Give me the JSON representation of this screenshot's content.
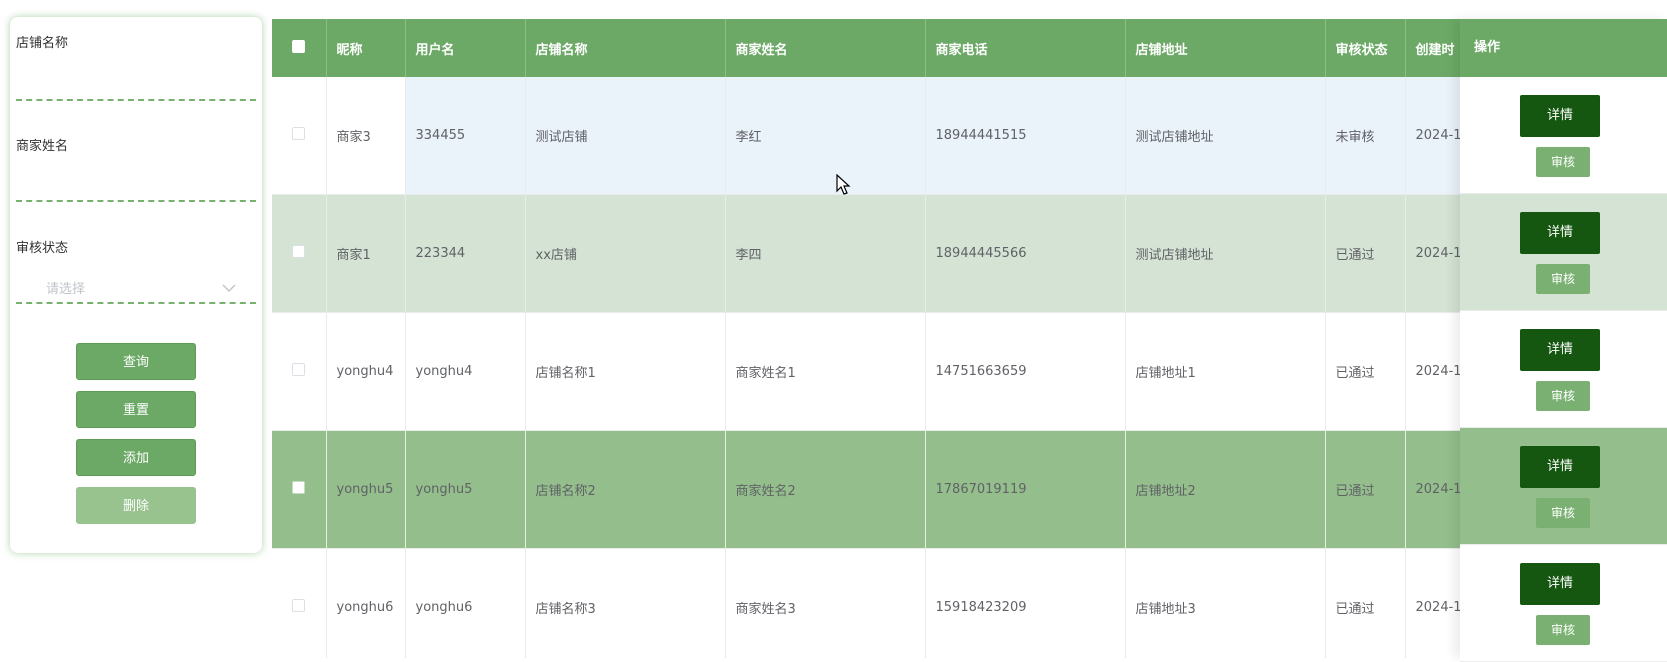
{
  "search": {
    "shop_name_label": "店铺名称",
    "merchant_name_label": "商家姓名",
    "audit_status_label": "审核状态",
    "audit_status_placeholder": "请选择",
    "query_label": "查询",
    "reset_label": "重置",
    "add_label": "添加",
    "delete_label": "删除"
  },
  "table": {
    "headers": {
      "nickname": "昵称",
      "username": "用户名",
      "shop_name": "店铺名称",
      "merchant_name": "商家姓名",
      "phone": "商家电话",
      "address": "店铺地址",
      "status": "审核状态",
      "created": "创建时",
      "actions": "操作"
    },
    "rows": [
      {
        "nickname": "商家3",
        "username": "334455",
        "shop_name": "测试店铺",
        "merchant_name": "李红",
        "phone": "18944441515",
        "address": "测试店铺地址",
        "status": "未审核",
        "created": "2024-1"
      },
      {
        "nickname": "商家1",
        "username": "223344",
        "shop_name": "xx店铺",
        "merchant_name": "李四",
        "phone": "18944445566",
        "address": "测试店铺地址",
        "status": "已通过",
        "created": "2024-1"
      },
      {
        "nickname": "yonghu4",
        "username": "yonghu4",
        "shop_name": "店铺名称1",
        "merchant_name": "商家姓名1",
        "phone": "14751663659",
        "address": "店铺地址1",
        "status": "已通过",
        "created": "2024-1"
      },
      {
        "nickname": "yonghu5",
        "username": "yonghu5",
        "shop_name": "店铺名称2",
        "merchant_name": "商家姓名2",
        "phone": "17867019119",
        "address": "店铺地址2",
        "status": "已通过",
        "created": "2024-1"
      },
      {
        "nickname": "yonghu6",
        "username": "yonghu6",
        "shop_name": "店铺名称3",
        "merchant_name": "商家姓名3",
        "phone": "15918423209",
        "address": "店铺地址3",
        "status": "已通过",
        "created": "2024-1"
      }
    ],
    "detail_label": "详情",
    "audit_label": "审核"
  },
  "colors": {
    "primary": "#6ca966",
    "detail_button": "#155710",
    "selected_row": "#94bf8c",
    "hover_row": "#eaf2fa"
  }
}
